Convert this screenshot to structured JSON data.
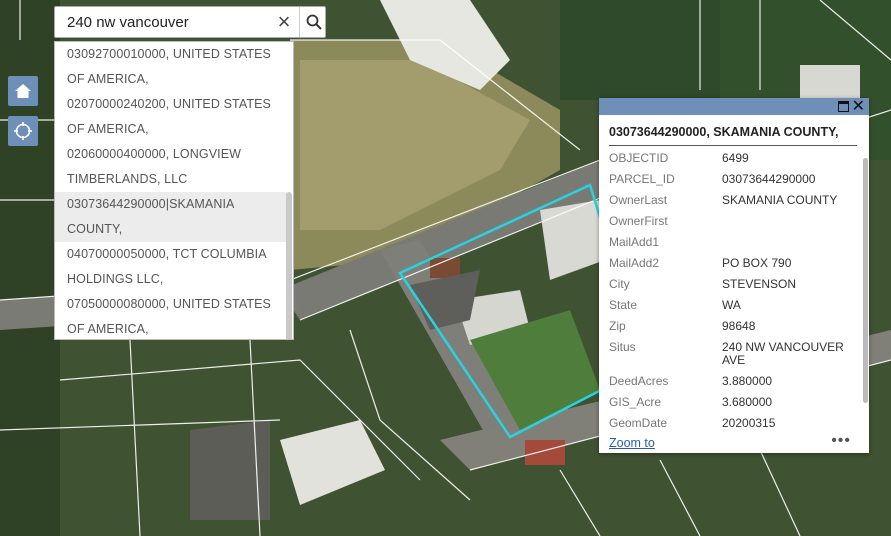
{
  "search": {
    "value": "240 nw vancouver",
    "clear_icon": "×",
    "suggestions": [
      "03092700010000, UNITED STATES",
      "OF AMERICA,",
      "02070000240200, UNITED STATES",
      "OF AMERICA,",
      "02060000400000, LONGVIEW",
      "TIMBERLANDS, LLC",
      "03073644290000|SKAMANIA",
      "COUNTY,",
      "04070000050000, TCT COLUMBIA",
      "HOLDINGS LLC,",
      "07050000080000, UNITED STATES",
      "OF AMERICA,"
    ]
  },
  "popup": {
    "title": "03073644290000, SKAMANIA COUNTY,",
    "fields": [
      {
        "key": "OBJECTID",
        "value": "6499"
      },
      {
        "key": "PARCEL_ID",
        "value": "03073644290000"
      },
      {
        "key": "OwnerLast",
        "value": "SKAMANIA COUNTY"
      },
      {
        "key": "OwnerFirst",
        "value": ""
      },
      {
        "key": "MailAdd1",
        "value": ""
      },
      {
        "key": "MailAdd2",
        "value": "PO BOX 790"
      },
      {
        "key": "City",
        "value": "STEVENSON"
      },
      {
        "key": "State",
        "value": "WA"
      },
      {
        "key": "Zip",
        "value": "98648"
      },
      {
        "key": "Situs",
        "value": "240 NW VANCOUVER AVE"
      },
      {
        "key": "DeedAcres",
        "value": "3.880000"
      },
      {
        "key": "GIS_Acre",
        "value": "3.680000"
      },
      {
        "key": "GeomDate",
        "value": "20200315"
      }
    ],
    "zoom_label": "Zoom to",
    "more_label": "•••"
  },
  "colors": {
    "accent": "#6e8fb8",
    "parcel_highlight": "#27d3e0"
  }
}
